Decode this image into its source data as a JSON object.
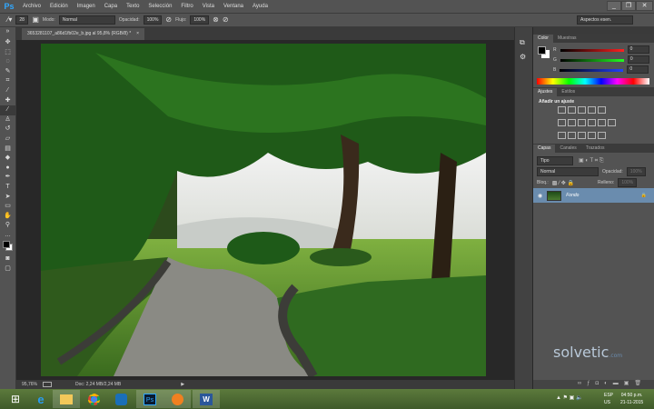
{
  "app": {
    "logo": "Ps"
  },
  "menu": [
    "Archivo",
    "Edición",
    "Imagen",
    "Capa",
    "Texto",
    "Selección",
    "Filtro",
    "Vista",
    "Ventana",
    "Ayuda"
  ],
  "window_controls": {
    "minimize": "_",
    "restore": "❐",
    "close": "✕"
  },
  "options": {
    "brush_size": "28",
    "mode_label": "Modo:",
    "mode_value": "Normal",
    "opacity_label": "Opacidad:",
    "opacity_value": "100%",
    "flow_label": "Flujo:",
    "flow_value": "100%",
    "workspace": "Aspectos esen."
  },
  "document_tab": {
    "title": "3653281107_a86d1fb02e_b.jpg al 95,8% (RGB/8) *",
    "close": "×"
  },
  "status": {
    "zoom": "95,76%",
    "doc": "Doc: 2,24 MB/2,24 MB"
  },
  "color_panel": {
    "tabs": [
      "Color",
      "Muestras"
    ],
    "channels": [
      {
        "name": "R",
        "value": "0",
        "color": "#ff2020"
      },
      {
        "name": "G",
        "value": "0",
        "color": "#20ff20"
      },
      {
        "name": "B",
        "value": "0",
        "color": "#2040ff"
      }
    ]
  },
  "adjust_panel": {
    "tabs": [
      "Ajustes",
      "Estilos"
    ],
    "heading": "Añadir un ajuste"
  },
  "layers_panel": {
    "tabs": [
      "Capas",
      "Canales",
      "Trazados"
    ],
    "filter": "Tipo",
    "blend": "Normal",
    "opacity_label": "Opacidad:",
    "opacity_value": "100%",
    "lock_label": "Bloq.:",
    "fill_label": "Relleno:",
    "fill_value": "100%",
    "layers": [
      {
        "name": "Fondo",
        "visible": true,
        "locked": true
      }
    ]
  },
  "watermark": {
    "brand": "solvetic",
    "tld": ".com"
  },
  "tray": {
    "lang1": "ESP",
    "lang2": "US",
    "time": "04:50 p.m.",
    "date": "21-11-2015"
  }
}
